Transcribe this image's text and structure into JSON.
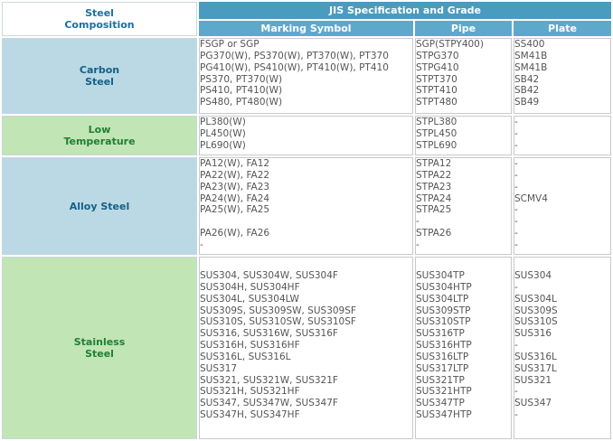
{
  "header": {
    "steel_composition": [
      "Steel",
      "Composition"
    ],
    "jis_title": "JIS Specification and Grade",
    "columns": {
      "marking_symbol": "Marking Symbol",
      "pipe": "Pipe",
      "plate": "Plate"
    }
  },
  "rows": [
    {
      "category": [
        "Carbon",
        "Steel"
      ],
      "marking": [
        "FSGP or SGP",
        "PG370(W), PS370(W), PT370(W), PT370",
        "PG410(W), PS410(W), PT410(W), PT410",
        "PS370, PT370(W)",
        "PS410, PT410(W)",
        "PS480, PT480(W)"
      ],
      "pipe": [
        "SGP(STPY400)",
        "STPG370",
        "STPG410",
        "STPT370",
        "STPT410",
        "STPT480"
      ],
      "plate": [
        "SS400",
        "SM41B",
        "SM41B",
        "SB42",
        "SB42",
        "SB49"
      ]
    },
    {
      "category": [
        "Low",
        "Temperature"
      ],
      "marking": [
        "PL380(W)",
        "PL450(W)",
        "PL690(W)"
      ],
      "pipe": [
        "STPL380",
        "STPL450",
        "STPL690"
      ],
      "plate": [
        "-",
        "-",
        "-"
      ]
    },
    {
      "category": [
        "Alloy Steel"
      ],
      "marking": [
        "PA12(W), FA12",
        "PA22(W), FA22",
        "PA23(W), FA23",
        "PA24(W), FA24",
        "PA25(W), FA25",
        "",
        "PA26(W), FA26",
        "-"
      ],
      "pipe": [
        "STPA12",
        "STPA22",
        "STPA23",
        "STPA24",
        "STPA25",
        "-",
        "STPA26",
        "-"
      ],
      "plate": [
        "-",
        "-",
        "-",
        "SCMV4",
        "-",
        "-",
        "-",
        "-"
      ]
    },
    {
      "category": [
        "Stainless",
        "Steel"
      ],
      "marking": [
        "SUS304, SUS304W, SUS304F",
        "SUS304H, SUS304HF",
        "SUS304L, SUS304LW",
        "SUS309S, SUS309SW, SUS309SF",
        "SUS310S, SUS310SW, SUS310SF",
        "SUS316, SUS316W, SUS316F",
        "SUS316H, SUS316HF",
        "SUS316L, SUS316L",
        "SUS317",
        "SUS321, SUS321W, SUS321F",
        "SUS321H, SUS321HF",
        "SUS347, SUS347W, SUS347F",
        "SUS347H, SUS347HF"
      ],
      "pipe": [
        "SUS304TP",
        "SUS304HTP",
        "SUS304LTP",
        "SUS309STP",
        "SUS310STP",
        "SUS316TP",
        "SUS316HTP",
        "SUS316LTP",
        "SUS317LTP",
        "SUS321TP",
        "SUS321HTP",
        "SUS347TP",
        "SUS347HTP"
      ],
      "plate": [
        "SUS304",
        "-",
        "SUS304L",
        "SUS309S",
        "SUS310S",
        "SUS316",
        "-",
        "SUS316L",
        "SUS317L",
        "SUS321",
        "-",
        "SUS347",
        "-"
      ]
    }
  ]
}
